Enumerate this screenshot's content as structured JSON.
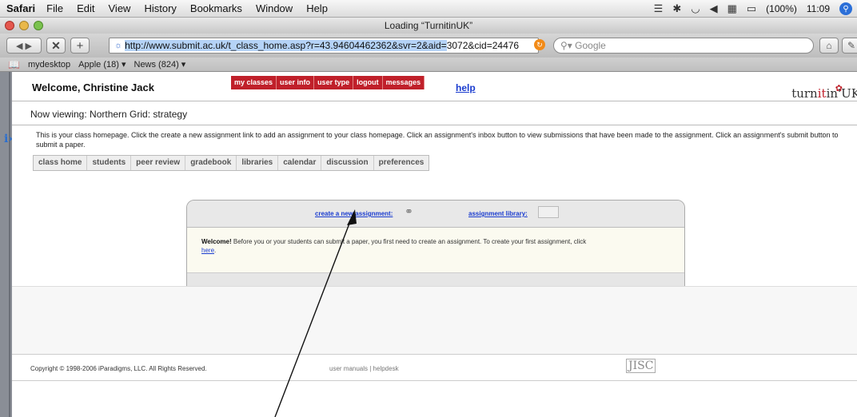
{
  "menubar": {
    "app": "Safari",
    "items": [
      "File",
      "Edit",
      "View",
      "History",
      "Bookmarks",
      "Window",
      "Help"
    ],
    "battery": "(100%)",
    "clock": "11:09"
  },
  "window": {
    "title": "Loading “TurnitinUK”"
  },
  "toolbar": {
    "url_selected": "http://www.submit.ac.uk/t_class_home.asp?r=43.94604462362&svr=2&aid=",
    "url_rest": "3072&cid=24476",
    "search_placeholder": "Google"
  },
  "bookmarks": [
    "mydesktop",
    "Apple (18) ▾",
    "News (824) ▾"
  ],
  "page": {
    "welcome": "Welcome, Christine Jack",
    "topnav": [
      "my classes",
      "user info",
      "user type",
      "logout",
      "messages"
    ],
    "help": "help",
    "logo_pre": "turn",
    "logo_it": "it",
    "logo_post": "in'UK",
    "now_viewing": "Now viewing: Northern Grid: strategy",
    "info": "This is your class homepage. Click the create a new assignment link to add an assignment to your class homepage. Click an assignment's inbox button to view submissions that have been made to the assignment. Click an assignment's submit button to submit a paper.",
    "tabs": [
      "class home",
      "students",
      "peer review",
      "gradebook",
      "libraries",
      "calendar",
      "discussion",
      "preferences"
    ],
    "create_link": "create a new assignment:",
    "library_link": "assignment library:",
    "welcome_bold": "Welcome!",
    "welcome_msg": " Before you or your students can submit a paper, you first need to create an assignment. To create your first assignment, click ",
    "here": "here",
    "copyright": "Copyright © 1998-2006 iParadigms, LLC. All Rights Reserved.",
    "footer_links": "user manuals | helpdesk",
    "jisc": "JISC"
  }
}
